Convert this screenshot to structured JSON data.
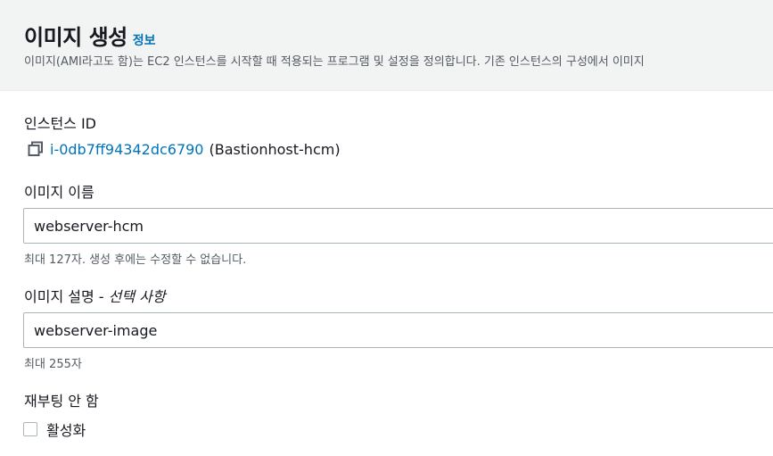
{
  "header": {
    "title": "이미지 생성",
    "info_link": "정보",
    "description": "이미지(AMI라고도 함)는 EC2 인스턴스를 시작할 때 적용되는 프로그램 및 설정을 정의합니다. 기존 인스턴스의 구성에서 이미지"
  },
  "instance": {
    "label": "인스턴스 ID",
    "id": "i-0db7ff94342dc6790",
    "name": "(Bastionhost-hcm)",
    "copy_icon": "copy-icon"
  },
  "image_name": {
    "label": "이미지 이름",
    "value": "webserver-hcm",
    "hint": "최대 127자. 생성 후에는 수정할 수 없습니다."
  },
  "image_description": {
    "label": "이미지 설명 - ",
    "optional_label": "선택 사항",
    "value": "webserver-image",
    "hint": "최대 255자"
  },
  "no_reboot": {
    "label": "재부팅 안 함",
    "checkbox_label": "활성화",
    "checked": false
  },
  "colors": {
    "link": "#0073bb",
    "header_bg": "#f2f3f3",
    "text": "#16191f",
    "secondary_text": "#545b64",
    "border": "#aab7b8"
  }
}
